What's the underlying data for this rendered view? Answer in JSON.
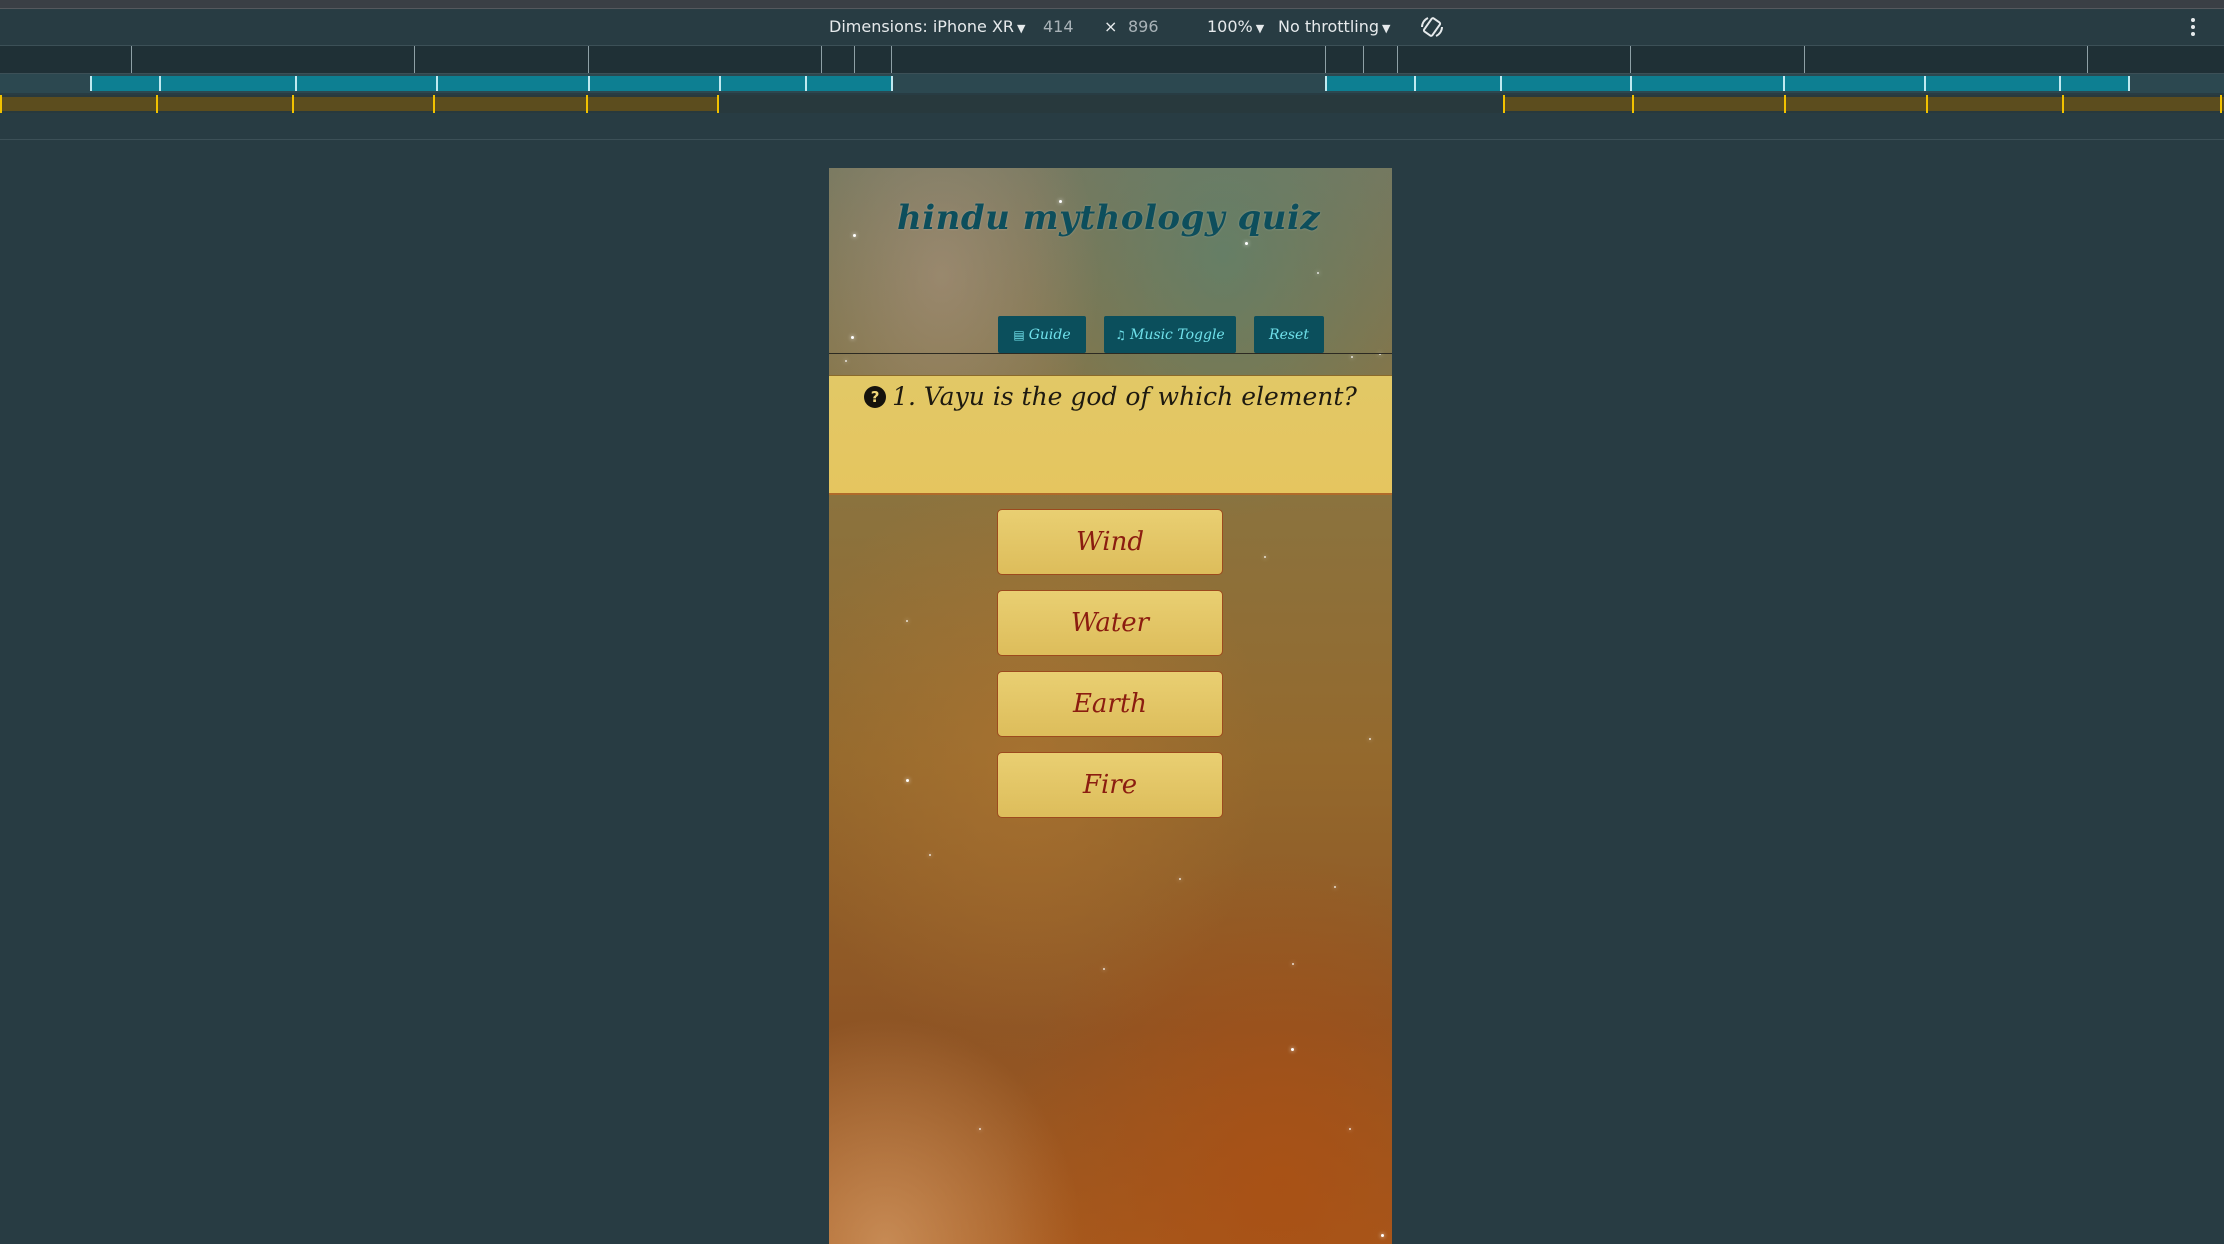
{
  "devtools": {
    "dimensions_label": "Dimensions: iPhone XR",
    "width_value": "414",
    "times_sign": "×",
    "height_value": "896",
    "zoom": "100%",
    "throttling": "No throttling",
    "caret": "▼",
    "icons": [
      "rotate-icon",
      "more-options-icon"
    ]
  },
  "app": {
    "title": "hindu mythology quiz",
    "nav": {
      "guide": "Guide",
      "music": "Music Toggle",
      "reset": "Reset"
    },
    "nav_icons": [
      "list-icon",
      "music-note-icon"
    ],
    "question": {
      "text": "1. Vayu is the god of which element?",
      "icon": "question-circle-icon"
    },
    "answers": [
      "Wind",
      "Water",
      "Earth",
      "Fire"
    ],
    "colors": {
      "header_text": "#0d4e5c",
      "nav_button_bg": "#0b4f5c",
      "nav_button_text": "#6fe0ea",
      "question_bg": "#e2c866",
      "answer_bg": "#e3c766",
      "answer_text": "#8b1d10"
    }
  }
}
